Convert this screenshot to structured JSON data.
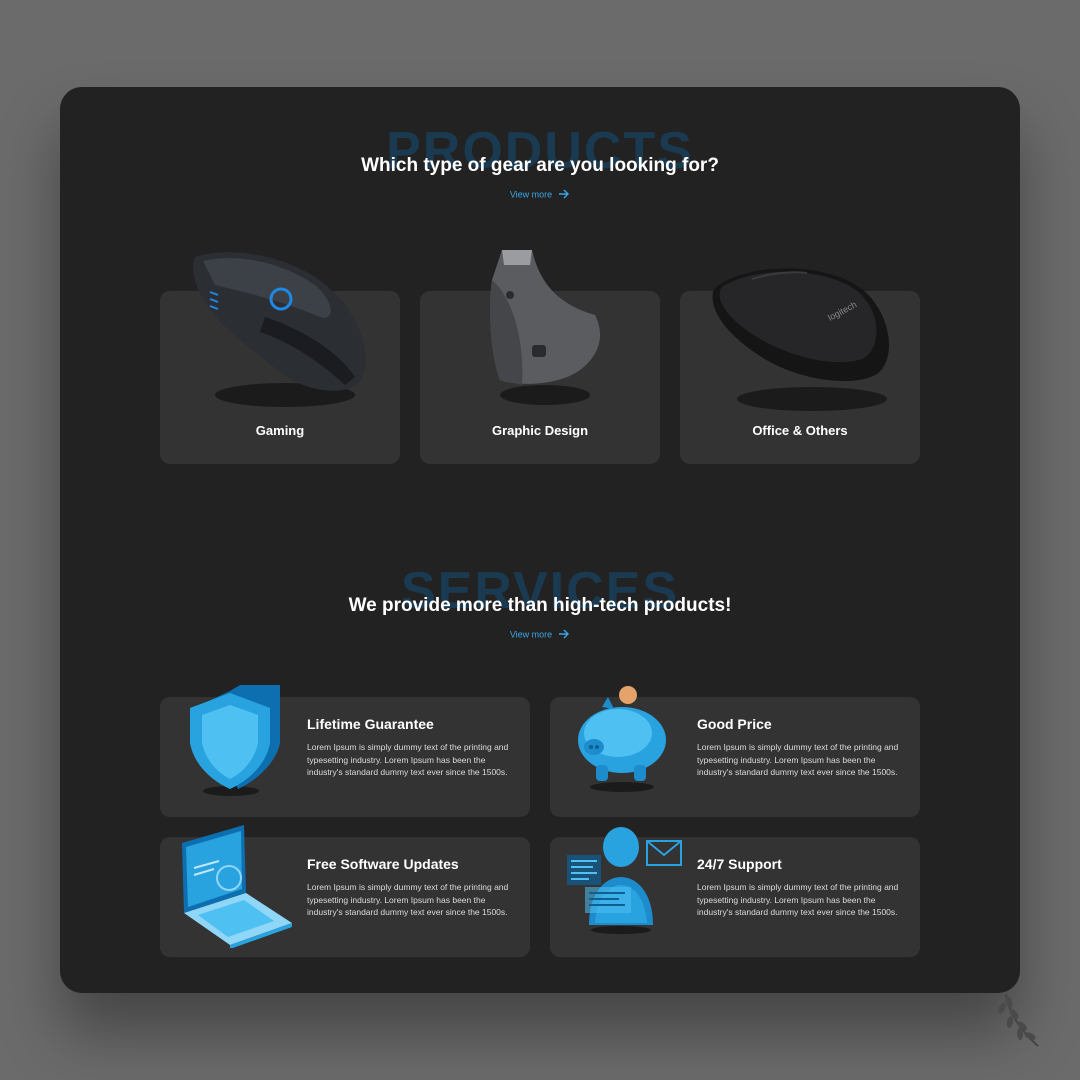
{
  "products": {
    "bg_word": "PRODUCTS",
    "headline": "Which type of gear are you looking for?",
    "view_more": "View more",
    "cards": [
      {
        "label": "Gaming",
        "icon": "gaming-mouse-icon"
      },
      {
        "label": "Graphic Design",
        "icon": "vertical-mouse-icon"
      },
      {
        "label": "Office & Others",
        "icon": "office-mouse-icon"
      }
    ]
  },
  "services": {
    "bg_word": "SERVICES",
    "headline": "We provide more than high-tech products!",
    "view_more": "View more",
    "cards": [
      {
        "title": "Lifetime Guarantee",
        "desc": "Lorem Ipsum is simply dummy text of the printing and typesetting industry. Lorem Ipsum has been the industry's standard dummy text ever since the 1500s.",
        "icon": "shield-icon"
      },
      {
        "title": "Good Price",
        "desc": "Lorem Ipsum is simply dummy text of the printing and typesetting industry. Lorem Ipsum has been the industry's standard dummy text ever since the 1500s.",
        "icon": "piggy-bank-icon"
      },
      {
        "title": "Free Software Updates",
        "desc": "Lorem Ipsum is simply dummy text of the printing and typesetting industry. Lorem Ipsum has been the industry's standard dummy text ever since the 1500s.",
        "icon": "laptop-icon"
      },
      {
        "title": "24/7 Support",
        "desc": "Lorem Ipsum is simply dummy text of the printing and typesetting industry. Lorem Ipsum has been the industry's standard dummy text ever since the 1500s.",
        "icon": "support-agent-icon"
      }
    ]
  },
  "colors": {
    "background": "#6b6b6b",
    "panel": "#222222",
    "card": "#333333",
    "accent": "#3aa6e8",
    "watermark": "#1a3a52"
  }
}
